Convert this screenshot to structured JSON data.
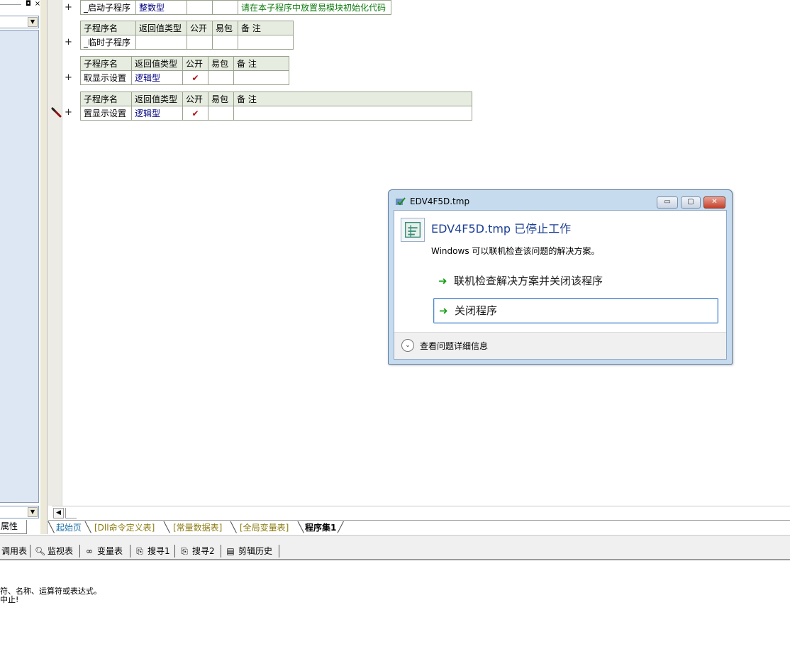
{
  "left_panel": {
    "pin_glyph": "◘",
    "close_glyph": "×",
    "bottom_tab_label": "属性"
  },
  "subroutine_tables": [
    {
      "header": [
        "子程序名",
        "返回值类型",
        "公开",
        "易包",
        "备 注"
      ],
      "row": {
        "name": "_启动子程序",
        "return_type": "整数型",
        "public": "",
        "easy_pkg": "",
        "note": "请在本子程序中放置易模块初始化代码"
      }
    },
    {
      "header": [
        "子程序名",
        "返回值类型",
        "公开",
        "易包",
        "备 注"
      ],
      "row": {
        "name": "_临时子程序",
        "return_type": "",
        "public": "",
        "easy_pkg": "",
        "note": ""
      }
    },
    {
      "header": [
        "子程序名",
        "返回值类型",
        "公开",
        "易包",
        "备 注"
      ],
      "row": {
        "name": "取显示设置",
        "return_type": "逻辑型",
        "public": "✔",
        "easy_pkg": "",
        "note": ""
      }
    },
    {
      "header": [
        "子程序名",
        "返回值类型",
        "公开",
        "易包",
        "备 注"
      ],
      "row": {
        "name": "置显示设置",
        "return_type": "逻辑型",
        "public": "✔",
        "easy_pkg": "",
        "note": ""
      }
    }
  ],
  "expand_glyph": "+",
  "editor_tabs": [
    {
      "label": "起始页",
      "color": "#1a6fa8",
      "bold": false
    },
    {
      "label": "[Dll命令定义表]",
      "color": "#8a7a10",
      "bold": false
    },
    {
      "label": "[常量数据表]",
      "color": "#8a7a10",
      "bold": false
    },
    {
      "label": "[全局变量表]",
      "color": "#8a7a10",
      "bold": false
    },
    {
      "label": "程序集1",
      "color": "#000000",
      "bold": true
    }
  ],
  "toolbar": {
    "items": [
      {
        "label": "调用表",
        "icon": ""
      },
      {
        "label": "监视表",
        "icon": "magnifier-icon"
      },
      {
        "label": "变量表",
        "icon": "glasses-icon"
      },
      {
        "label": "搜寻1",
        "icon": "search-doc-icon"
      },
      {
        "label": "搜寻2",
        "icon": "search-doc-icon"
      },
      {
        "label": "剪辑历史",
        "icon": "clipboard-icon"
      }
    ]
  },
  "output": {
    "line1": "符、名称、运算符或表达式。",
    "line2": "中止!"
  },
  "dialog": {
    "title": "EDV4F5D.tmp",
    "heading": "EDV4F5D.tmp 已停止工作",
    "description": "Windows 可以联机检查该问题的解决方案。",
    "option_check_online": "联机检查解决方案并关闭该程序",
    "option_close": "关闭程序",
    "details": "查看问题详细信息",
    "minimize_glyph": "▭",
    "maximize_glyph": "▢",
    "close_glyph": "✕",
    "arrow_glyph": "➜",
    "details_glyph": "⌄"
  }
}
